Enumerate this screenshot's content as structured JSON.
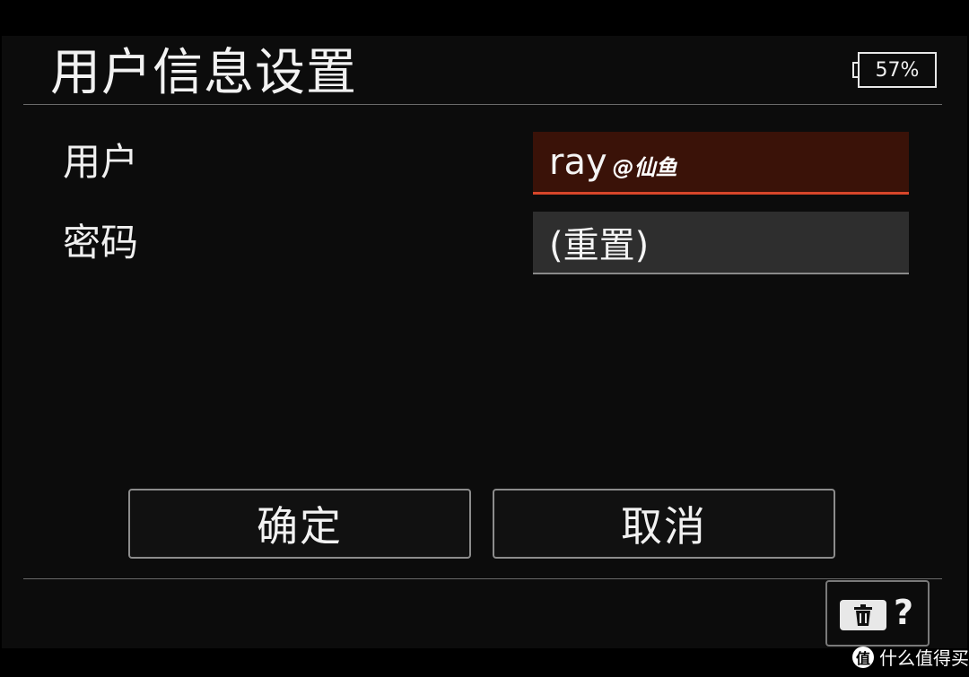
{
  "header": {
    "title": "用户信息设置",
    "battery": "57%"
  },
  "form": {
    "user": {
      "label": "用户",
      "value": "ray",
      "watermark": "@仙鱼"
    },
    "password": {
      "label": "密码",
      "value": "(重置)"
    }
  },
  "buttons": {
    "ok": "确定",
    "cancel": "取消"
  },
  "footer": {
    "help_symbol": "?",
    "brand_logo": "值",
    "brand_text": "什么值得买"
  },
  "colors": {
    "active_field_bg": "#3a1208",
    "active_field_underline": "#d8462a",
    "inactive_field_bg": "#2e2e2e"
  }
}
